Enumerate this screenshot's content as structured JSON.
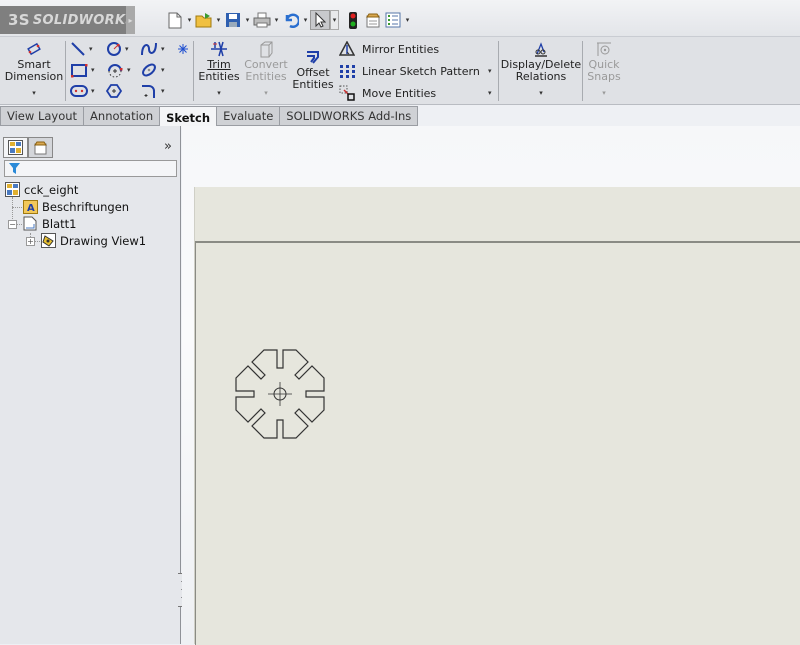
{
  "app": {
    "brand": "SOLIDWORKS",
    "brand_mark": "3S"
  },
  "quick_access": [
    {
      "name": "new",
      "icon": "new-document-icon",
      "has_dropdown": true
    },
    {
      "name": "open",
      "icon": "open-folder-icon",
      "has_dropdown": true
    },
    {
      "name": "save",
      "icon": "save-icon",
      "has_dropdown": true
    },
    {
      "name": "print",
      "icon": "print-icon",
      "has_dropdown": true
    },
    {
      "name": "undo",
      "icon": "undo-icon",
      "has_dropdown": true
    },
    {
      "name": "select",
      "icon": "cursor-icon",
      "has_dropdown": true
    },
    {
      "name": "rebuild",
      "icon": "traffic-light-icon",
      "has_dropdown": false
    },
    {
      "name": "file-properties",
      "icon": "file-properties-icon",
      "has_dropdown": false
    },
    {
      "name": "options",
      "icon": "options-list-icon",
      "has_dropdown": true
    }
  ],
  "ribbon": {
    "smart_dimension": {
      "line1": "Smart",
      "line2": "Dimension"
    },
    "trim_entities": {
      "line1": "Trim",
      "line2": "Entities"
    },
    "convert_entities": {
      "line1": "Convert",
      "line2": "Entities",
      "enabled": false
    },
    "offset_entities": {
      "line1": "Offset",
      "line2": "Entities"
    },
    "mirror_entities": "Mirror Entities",
    "linear_sketch_pattern": "Linear Sketch Pattern",
    "move_entities": "Move Entities",
    "display_delete_relations": {
      "line1": "Display/Delete",
      "line2": "Relations"
    },
    "quick_snaps": {
      "line1": "Quick",
      "line2": "Snaps",
      "enabled": false
    },
    "sketch_tools": [
      "line",
      "circle",
      "spline",
      "point",
      "rectangle",
      "arc",
      "ellipse",
      "slot",
      "polygon",
      "fillet"
    ]
  },
  "tabs": [
    {
      "label": "View Layout",
      "active": false
    },
    {
      "label": "Annotation",
      "active": false
    },
    {
      "label": "Sketch",
      "active": true
    },
    {
      "label": "Evaluate",
      "active": false
    },
    {
      "label": "SOLIDWORKS Add-Ins",
      "active": false
    }
  ],
  "feature_tree": {
    "expand_glyph": "»",
    "items": [
      {
        "label": "cck_eight",
        "icon": "drawing-icon",
        "level": 0
      },
      {
        "label": "Beschriftungen",
        "icon": "annotations-folder-icon",
        "level": 1
      },
      {
        "label": "Blatt1",
        "icon": "sheet-icon",
        "level": 1,
        "expanded": true
      },
      {
        "label": "Drawing View1",
        "icon": "drawing-view-icon",
        "level": 2,
        "expanded": false
      }
    ]
  },
  "colors": {
    "sketch_blue": "#1f3fa8",
    "sheet_bg": "#e6e6dd",
    "ribbon_bg": "#dfe1e5"
  }
}
